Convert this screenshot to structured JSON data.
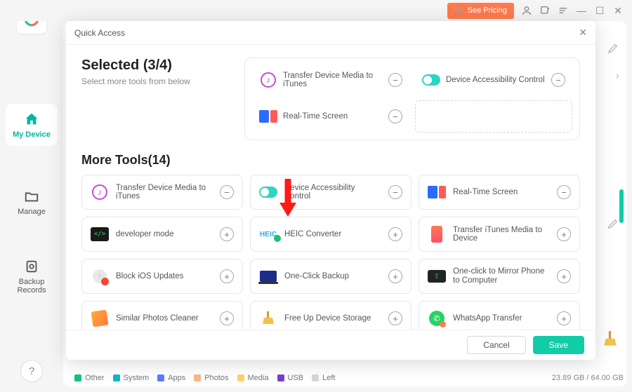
{
  "topbar": {
    "pricing_label": "See Pricing"
  },
  "sidebar": {
    "items": [
      {
        "label": "My Device"
      },
      {
        "label": "Manage"
      },
      {
        "label": "Backup Records"
      }
    ]
  },
  "modal": {
    "title": "Quick Access",
    "selected_header": "Selected (3/4)",
    "selected_sub": "Select more tools from below",
    "selected": [
      {
        "key": "transfer-device-media-to-itunes",
        "label": "Transfer Device Media to iTunes",
        "action": "remove"
      },
      {
        "key": "device-accessibility-control",
        "label": "Device Accessibility Control",
        "action": "remove"
      },
      {
        "key": "real-time-screen",
        "label": "Real-Time Screen",
        "action": "remove"
      }
    ],
    "more_header": "More Tools(14)",
    "tools": [
      {
        "key": "transfer-device-media-to-itunes",
        "label": "Transfer Device Media to iTunes",
        "action": "remove"
      },
      {
        "key": "device-accessibility-control",
        "label": "Device Accessibility Control",
        "action": "remove"
      },
      {
        "key": "real-time-screen",
        "label": "Real-Time Screen",
        "action": "remove"
      },
      {
        "key": "developer-mode",
        "label": "developer mode",
        "action": "add"
      },
      {
        "key": "heic-converter",
        "label": "HEIC Converter",
        "action": "add"
      },
      {
        "key": "transfer-itunes-media-to-device",
        "label": "Transfer iTunes Media to Device",
        "action": "add"
      },
      {
        "key": "block-ios-updates",
        "label": "Block iOS Updates",
        "action": "add"
      },
      {
        "key": "one-click-backup",
        "label": "One-Click Backup",
        "action": "add"
      },
      {
        "key": "one-click-mirror",
        "label": "One-click to Mirror Phone to Computer",
        "action": "add"
      },
      {
        "key": "similar-photos-cleaner",
        "label": "Similar Photos Cleaner",
        "action": "add"
      },
      {
        "key": "free-up-device-storage",
        "label": "Free Up Device Storage",
        "action": "add"
      },
      {
        "key": "whatsapp-transfer",
        "label": "WhatsApp Transfer",
        "action": "add"
      }
    ],
    "cancel": "Cancel",
    "save": "Save"
  },
  "storage": {
    "legend": [
      {
        "label": "Other",
        "color": "#18c27a"
      },
      {
        "label": "System",
        "color": "#12b6cc"
      },
      {
        "label": "Apps",
        "color": "#5a7dff"
      },
      {
        "label": "Photos",
        "color": "#ffb48a"
      },
      {
        "label": "Media",
        "color": "#ffd36a"
      },
      {
        "label": "USB",
        "color": "#7a3fc9"
      },
      {
        "label": "Left",
        "color": "#d6d6d8"
      }
    ],
    "capacity": "23.89 GB / 64.00 GB"
  },
  "icons": {
    "dev_symbol": "</>",
    "heic_text": "HEIC",
    "up_arrow": "↑",
    "cast_symbol": "⇧",
    "wa_symbol": "✆"
  }
}
